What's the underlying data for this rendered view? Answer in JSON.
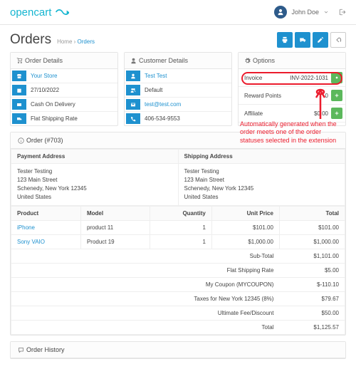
{
  "header": {
    "brand": "opencart",
    "user": "John Doe"
  },
  "page": {
    "title": "Orders",
    "home": "Home",
    "current": "Orders"
  },
  "orderDetails": {
    "title": "Order Details",
    "store": "Your Store",
    "date": "27/10/2022",
    "payment": "Cash On Delivery",
    "shipping": "Flat Shipping Rate"
  },
  "customerDetails": {
    "title": "Customer Details",
    "name": "Test Test",
    "group": "Default",
    "email": "test@test.com",
    "phone": "406-534-9553"
  },
  "options": {
    "title": "Options",
    "rows": [
      {
        "label": "Invoice",
        "value": "INV-2022-1031",
        "btn": "gen"
      },
      {
        "label": "Reward Points",
        "value": "0",
        "btn": "add"
      },
      {
        "label": "Affiliate",
        "value": "$0.00",
        "btn": "add"
      }
    ],
    "annotation": "Automatically generated when the order meets one of the order statuses selected in the extension"
  },
  "order": {
    "title": "Order (#703)",
    "addr_head": {
      "pay": "Payment Address",
      "ship": "Shipping Address"
    },
    "pay_addr": "Tester Testing\n123 Main Street\nSchenedy, New York 12345\nUnited States",
    "ship_addr": "Tester Testing\n123 Main Street\nSchenedy, New York 12345\nUnited States",
    "cols": {
      "product": "Product",
      "model": "Model",
      "qty": "Quantity",
      "price": "Unit Price",
      "total": "Total"
    },
    "lines": [
      {
        "product": "iPhone",
        "model": "product 11",
        "qty": "1",
        "price": "$101.00",
        "total": "$101.00"
      },
      {
        "product": "Sony VAIO",
        "model": "Product 19",
        "qty": "1",
        "price": "$1,000.00",
        "total": "$1,000.00"
      }
    ],
    "summary": [
      {
        "label": "Sub-Total",
        "value": "$1,101.00"
      },
      {
        "label": "Flat Shipping Rate",
        "value": "$5.00"
      },
      {
        "label": "My Coupon (MYCOUPON)",
        "value": "$-110.10"
      },
      {
        "label": "Taxes for New York 12345 (8%)",
        "value": "$79.67"
      },
      {
        "label": "Ultimate Fee/Discount",
        "value": "$50.00"
      },
      {
        "label": "Total",
        "value": "$1,125.57"
      }
    ]
  },
  "history": {
    "title": "Order History"
  }
}
